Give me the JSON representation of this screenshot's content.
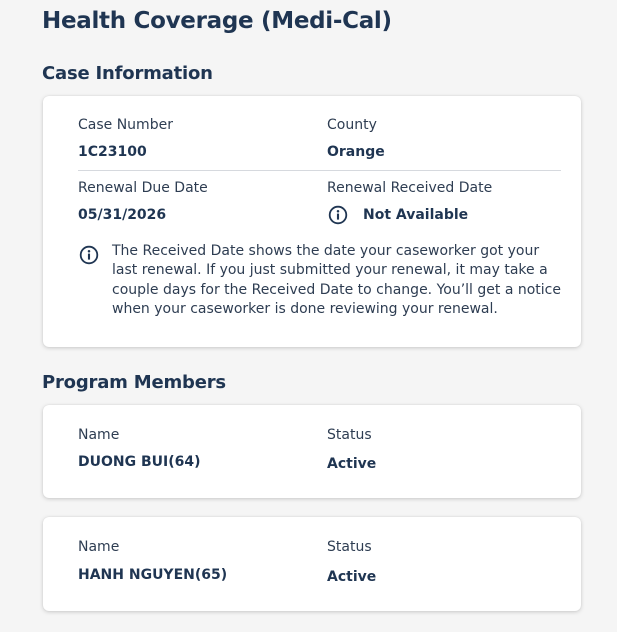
{
  "page_title": "Health Coverage (Medi-Cal)",
  "case_info": {
    "heading": "Case Information",
    "case_number_label": "Case Number",
    "case_number_value": "1C23100",
    "county_label": "County",
    "county_value": "Orange",
    "renewal_due_label": "Renewal Due Date",
    "renewal_due_value": "05/31/2026",
    "renewal_received_label": "Renewal Received Date",
    "renewal_received_value": "Not Available",
    "info_note": "The Received Date shows the date your caseworker got your last renewal. If you just submitted your renewal, it may take a couple days for the Received Date to change. You’ll get a notice when your caseworker is done reviewing your renewal."
  },
  "program_members": {
    "heading": "Program Members",
    "members": [
      {
        "name_label": "Name",
        "name_value": "DUONG BUI(64)",
        "status_label": "Status",
        "status_value": "Active"
      },
      {
        "name_label": "Name",
        "name_value": "HANH NGUYEN(65)",
        "status_label": "Status",
        "status_value": "Active"
      }
    ]
  },
  "colors": {
    "heading": "#1f3552",
    "text": "#2e3d52",
    "card_bg": "#ffffff",
    "page_bg": "#f5f5f5",
    "divider": "#d6d9de"
  },
  "icons": {
    "info": "info-circle-icon"
  }
}
